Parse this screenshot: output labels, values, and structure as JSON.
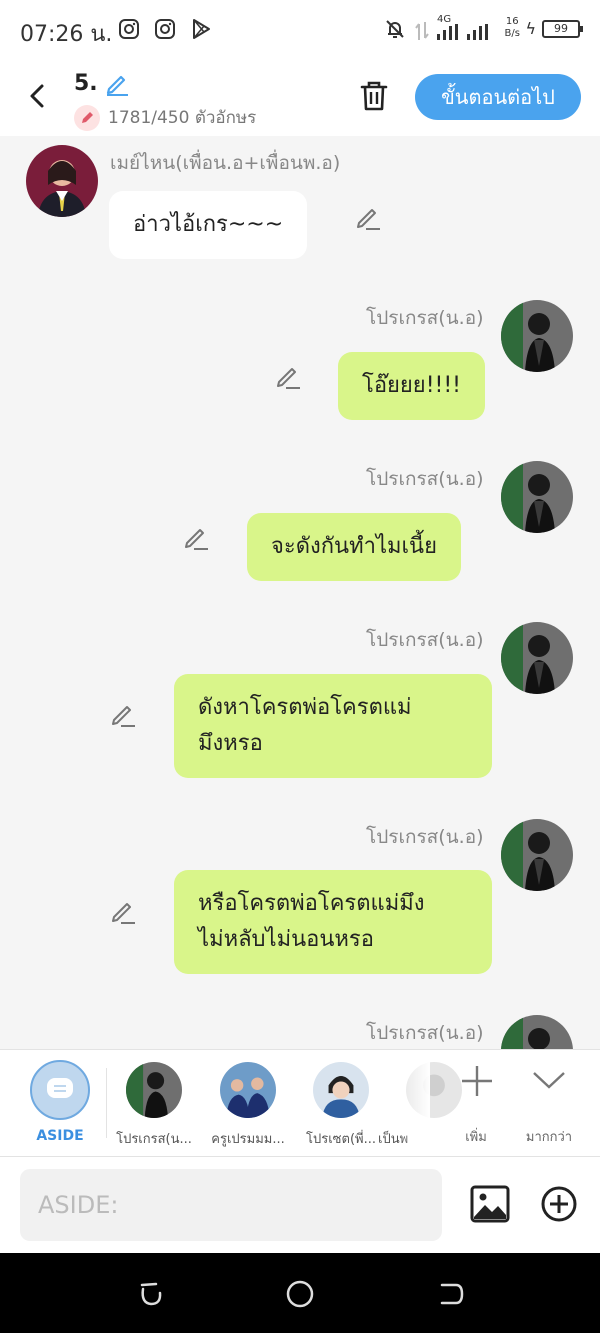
{
  "status_bar": {
    "time": "07:26 น.",
    "network_label": "4G",
    "net_speed_value": "16",
    "net_speed_unit": "B/s",
    "battery": "99"
  },
  "header": {
    "title": "5.",
    "char_count": "1781/450 ตัวอักษร",
    "next_button": "ขั้นตอนต่อไป"
  },
  "messages": [
    {
      "sender": "เมย์ไหน(เพื่อน.อ+เพื่อนพ.อ)",
      "text_lines": [
        "อ่าวไอ้เกร~~~"
      ],
      "side": "left"
    },
    {
      "sender": "โปรเกรส(น.อ)",
      "text_lines": [
        "โอ๊ยยย!!!!"
      ],
      "side": "right"
    },
    {
      "sender": "โปรเกรส(น.อ)",
      "text_lines": [
        "จะดังกันทำไมเนี้ย"
      ],
      "side": "right"
    },
    {
      "sender": "โปรเกรส(น.อ)",
      "text_lines": [
        "ดังหาโครตพ่อโครตแม่",
        "มึงหรอ"
      ],
      "side": "right"
    },
    {
      "sender": "โปรเกรส(น.อ)",
      "text_lines": [
        "หรือโครตพ่อโครตแม่มึง",
        "ไม่หลับไม่นอนหรอ"
      ],
      "side": "right"
    },
    {
      "sender": "โปรเกรส(น.อ)",
      "text_lines": [],
      "side": "right"
    }
  ],
  "character_strip": {
    "aside_label": "ASIDE",
    "characters": [
      {
        "label": "โปรเกรส(น..."
      },
      {
        "label": "ครูเปรมมม..."
      },
      {
        "label": "โปรเซต(พี่..."
      },
      {
        "label": "เป็นพ"
      }
    ],
    "add_label": "เพิ่ม",
    "more_label": "มากกว่า"
  },
  "input": {
    "placeholder": "ASIDE:"
  },
  "colors": {
    "accent": "#4aa3ee",
    "bubble_right": "#d9f58a",
    "bubble_left": "#ffffff",
    "chat_background": "#f5f5f5"
  }
}
